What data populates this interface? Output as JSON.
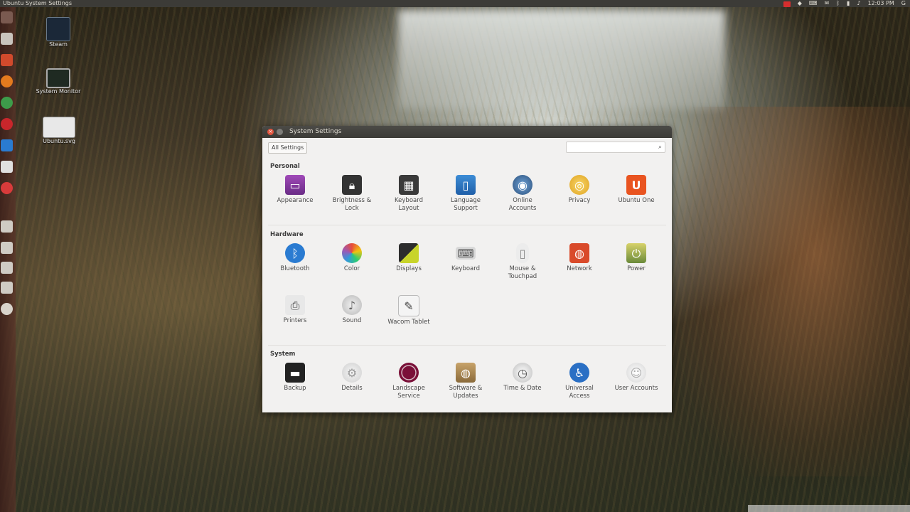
{
  "top_panel": {
    "title": "Ubuntu  System Settings",
    "clock": "12:03 PM",
    "user": "G"
  },
  "desktop_icons": [
    {
      "label": "Steam"
    },
    {
      "label": "System Monitor"
    },
    {
      "label": "Ubuntu.svg"
    }
  ],
  "window": {
    "title": "System Settings",
    "all_settings_label": "All Settings",
    "search_placeholder": "",
    "sections": {
      "personal": {
        "title": "Personal",
        "items": [
          {
            "line1": "Appearance",
            "line2": ""
          },
          {
            "line1": "Brightness &",
            "line2": "Lock"
          },
          {
            "line1": "Keyboard",
            "line2": "Layout"
          },
          {
            "line1": "Language",
            "line2": "Support"
          },
          {
            "line1": "Online",
            "line2": "Accounts"
          },
          {
            "line1": "Privacy",
            "line2": ""
          },
          {
            "line1": "Ubuntu One",
            "line2": ""
          }
        ]
      },
      "hardware": {
        "title": "Hardware",
        "items": [
          {
            "line1": "Bluetooth",
            "line2": ""
          },
          {
            "line1": "Color",
            "line2": ""
          },
          {
            "line1": "Displays",
            "line2": ""
          },
          {
            "line1": "Keyboard",
            "line2": ""
          },
          {
            "line1": "Mouse &",
            "line2": "Touchpad"
          },
          {
            "line1": "Network",
            "line2": ""
          },
          {
            "line1": "Power",
            "line2": ""
          },
          {
            "line1": "Printers",
            "line2": ""
          },
          {
            "line1": "Sound",
            "line2": ""
          },
          {
            "line1": "Wacom Tablet",
            "line2": ""
          }
        ]
      },
      "system": {
        "title": "System",
        "items": [
          {
            "line1": "Backup",
            "line2": ""
          },
          {
            "line1": "Details",
            "line2": ""
          },
          {
            "line1": "Landscape",
            "line2": "Service"
          },
          {
            "line1": "Software &",
            "line2": "Updates"
          },
          {
            "line1": "Time & Date",
            "line2": ""
          },
          {
            "line1": "Universal",
            "line2": "Access"
          },
          {
            "line1": "User Accounts",
            "line2": ""
          }
        ]
      }
    }
  },
  "colors": {
    "panel": "#3c3b37",
    "window_bg": "#f2f1f0",
    "close_button": "#e2553f",
    "launcher": "#5a3228"
  }
}
